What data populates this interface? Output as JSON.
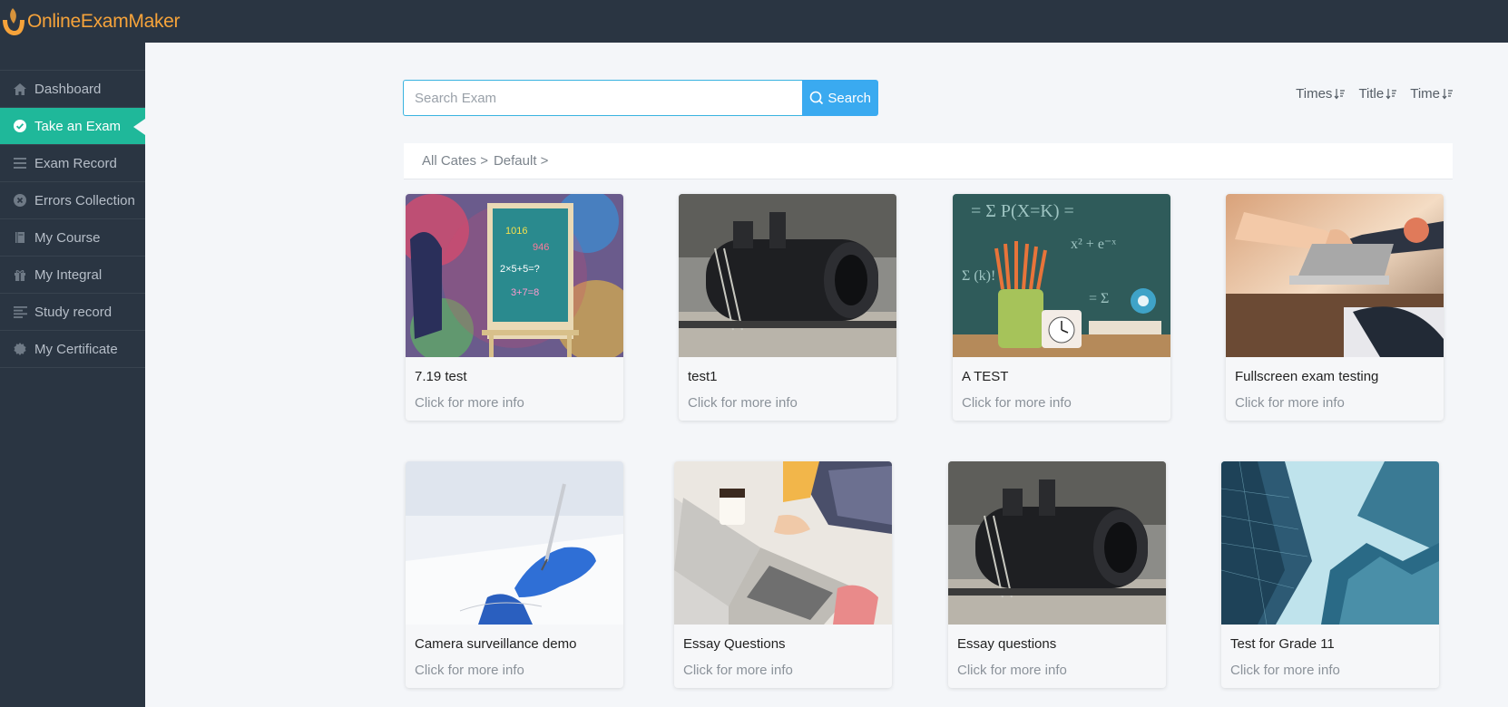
{
  "brand": {
    "name": "OnlineExamMaker",
    "color": "#f6a33a"
  },
  "sidebar": {
    "items": [
      {
        "label": "Dashboard",
        "icon": "home-icon"
      },
      {
        "label": "Take an Exam",
        "icon": "check-circle-icon",
        "active": true
      },
      {
        "label": "Exam Record",
        "icon": "list-icon"
      },
      {
        "label": "Errors Collection",
        "icon": "x-circle-icon"
      },
      {
        "label": "My Course",
        "icon": "book-icon"
      },
      {
        "label": "My Integral",
        "icon": "gift-icon"
      },
      {
        "label": "Study record",
        "icon": "align-left-icon"
      },
      {
        "label": "My Certificate",
        "icon": "badge-icon"
      }
    ]
  },
  "search": {
    "placeholder": "Search Exam",
    "button_label": "Search"
  },
  "sort": {
    "times": "Times",
    "title": "Title",
    "time": "Time"
  },
  "breadcrumb": {
    "root": "All Cates >",
    "current": "Default >"
  },
  "cards": [
    {
      "title": "7.19 test",
      "subtitle": "Click for more info",
      "image": "chalkboard-easel"
    },
    {
      "title": "test1",
      "subtitle": "Click for more info",
      "image": "steam-engine"
    },
    {
      "title": "A TEST",
      "subtitle": "Click for more info",
      "image": "pencils-clock"
    },
    {
      "title": "Fullscreen exam testing",
      "subtitle": "Click for more info",
      "image": "handshake-laptop"
    },
    {
      "title": "Camera surveillance demo",
      "subtitle": "Click for more info",
      "image": "gloved-hand-writing"
    },
    {
      "title": "Essay Questions",
      "subtitle": "Click for more info",
      "image": "laptop-coffee"
    },
    {
      "title": "Essay questions",
      "subtitle": "Click for more info",
      "image": "steam-engine"
    },
    {
      "title": "Test for Grade 11",
      "subtitle": "Click for more info",
      "image": "glass-skyscrapers"
    }
  ],
  "colors": {
    "sidebar_bg": "#2a3542",
    "active": "#1fb89a",
    "search_button": "#3aaaf0",
    "page_bg": "#f4f6f9"
  }
}
